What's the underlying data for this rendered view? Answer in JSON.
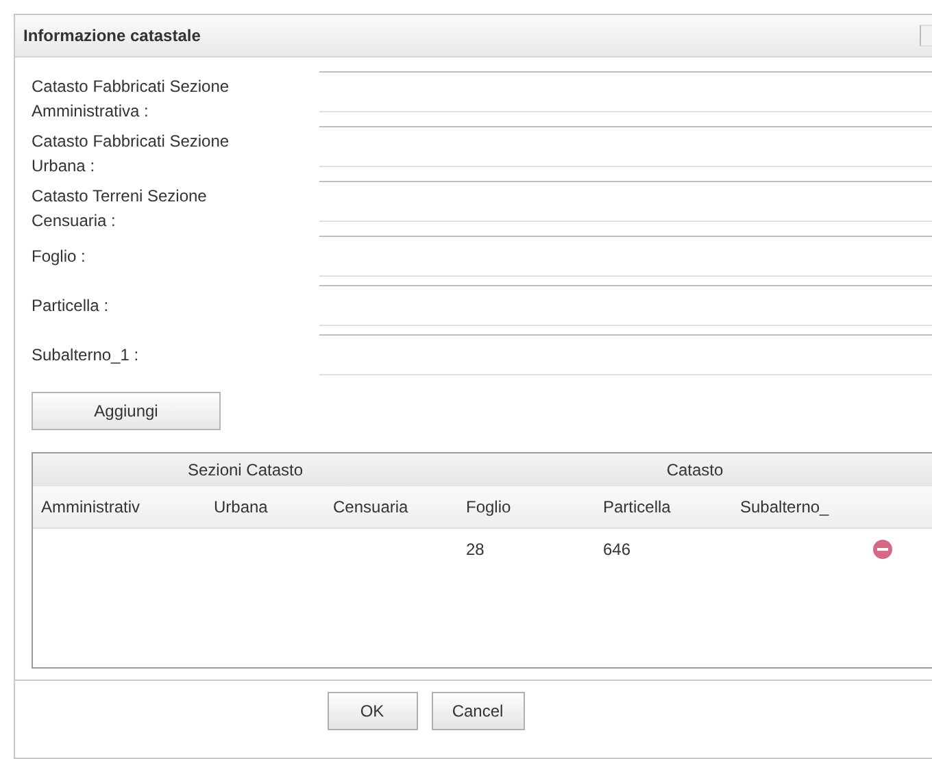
{
  "window": {
    "title": "Informazione catastale"
  },
  "form": {
    "fields": [
      {
        "label": "Catasto Fabbricati Sezione Amministrativa :"
      },
      {
        "label": "Catasto Fabbricati Sezione Urbana :"
      },
      {
        "label": "Catasto Terreni Sezione Censuaria :"
      },
      {
        "label": "Foglio :"
      },
      {
        "label": "Particella :"
      },
      {
        "label": "Subalterno_1 :"
      }
    ],
    "add_button": "Aggiungi"
  },
  "table": {
    "column_groups": [
      {
        "label": "Sezioni Catasto"
      },
      {
        "label": "Catasto"
      }
    ],
    "columns": [
      {
        "kind": "text",
        "label": "Amministrativ"
      },
      {
        "kind": "text",
        "label": "Urbana"
      },
      {
        "kind": "text",
        "label": "Censuaria"
      },
      {
        "kind": "text",
        "label": "Foglio"
      },
      {
        "kind": "text",
        "label": "Particella"
      },
      {
        "kind": "text",
        "label": "Subalterno_"
      },
      {
        "kind": "remove"
      }
    ],
    "rows": [
      {
        "cells": [
          null,
          null,
          null,
          "28",
          "646",
          null
        ],
        "removable": true
      }
    ]
  },
  "buttons": [
    "OK",
    "Cancel"
  ]
}
